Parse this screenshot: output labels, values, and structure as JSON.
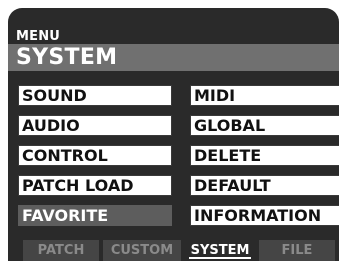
{
  "header": {
    "menu_label": "MENU",
    "title": "SYSTEM"
  },
  "menu": {
    "left": [
      "SOUND",
      "AUDIO",
      "CONTROL",
      "PATCH LOAD",
      "FAVORITE"
    ],
    "right": [
      "MIDI",
      "GLOBAL",
      "DELETE",
      "DEFAULT",
      "INFORMATION"
    ],
    "selected": "FAVORITE"
  },
  "tabs": [
    {
      "label": "PATCH",
      "active": false
    },
    {
      "label": "CUSTOM",
      "active": false
    },
    {
      "label": "SYSTEM",
      "active": true
    },
    {
      "label": "FILE",
      "active": false
    }
  ],
  "colors": {
    "screen_bg": "#2a2a2a",
    "title_bar": "#707070",
    "button_bg": "#ffffff",
    "button_selected": "#5d5d5d",
    "tab_inactive": "#454545"
  }
}
